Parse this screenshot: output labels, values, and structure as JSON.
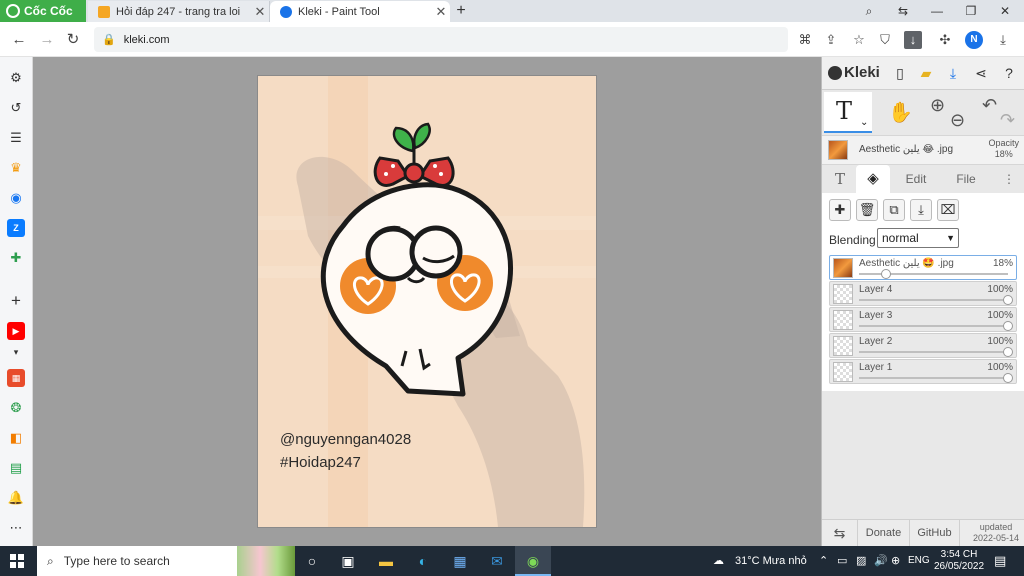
{
  "browser": {
    "brand": "Cốc Cốc",
    "tabs": [
      {
        "title": "Hỏi đáp 247 - trang tra loi",
        "active": false
      },
      {
        "title": "Kleki - Paint Tool",
        "active": true
      }
    ],
    "url": "kleki.com"
  },
  "canvas": {
    "watermark_line1": "@nguyenngan4028",
    "watermark_line2": "#Hoidap247"
  },
  "kleki": {
    "logo": "Kleki",
    "active_layer_name": "Aesthetic يلين 😂 .jpg",
    "opacity_label": "Opacity",
    "opacity_value": "18%",
    "tabs": [
      "Edit",
      "File"
    ],
    "blending_label": "Blending",
    "blending_value": "normal",
    "layers": [
      {
        "name": "Aesthetic يلين 🤩 .jpg",
        "opacity": "18%",
        "opacity_value": 0.18,
        "selected": true
      },
      {
        "name": "Layer 4",
        "opacity": "100%",
        "opacity_value": 1.0,
        "selected": false
      },
      {
        "name": "Layer 3",
        "opacity": "100%",
        "opacity_value": 1.0,
        "selected": false
      },
      {
        "name": "Layer 2",
        "opacity": "100%",
        "opacity_value": 1.0,
        "selected": false
      },
      {
        "name": "Layer 1",
        "opacity": "100%",
        "opacity_value": 1.0,
        "selected": false
      }
    ],
    "footer": {
      "donate": "Donate",
      "github": "GitHub",
      "updated_label": "updated",
      "updated_date": "2022-05-14"
    }
  },
  "taskbar": {
    "search_placeholder": "Type here to search",
    "weather": "31°C  Mưa nhỏ",
    "language": "ENG",
    "time": "3:54 CH",
    "date": "26/05/2022"
  },
  "colors": {
    "brand_green": "#3fae49",
    "canvas_bg": "#f5dcc4",
    "cheek_orange": "#f08a2c",
    "bow_red": "#d93b3b",
    "leaf_green": "#3fb24a",
    "accent_blue": "#1a73e8"
  }
}
